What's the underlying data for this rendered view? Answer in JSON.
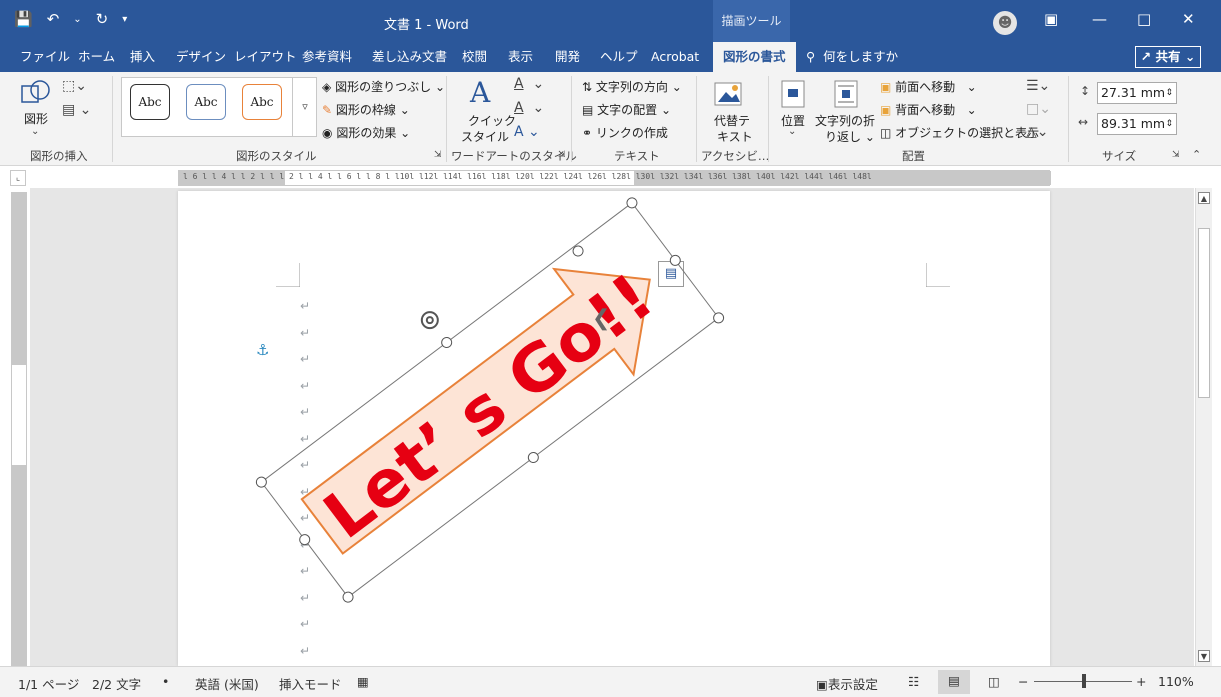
{
  "title_bar": {
    "document_title": "文書 1  -  Word",
    "context_tool": "描画ツール",
    "qat_icons": [
      "save-icon",
      "undo-icon",
      "redo-icon",
      "customize-icon"
    ]
  },
  "tabs": [
    {
      "label": "ファイル",
      "name": "tab-file"
    },
    {
      "label": "ホーム",
      "name": "tab-home"
    },
    {
      "label": "挿入",
      "name": "tab-insert"
    },
    {
      "label": "デザイン",
      "name": "tab-design"
    },
    {
      "label": "レイアウト",
      "name": "tab-layout"
    },
    {
      "label": "参考資料",
      "name": "tab-references"
    },
    {
      "label": "差し込み文書",
      "name": "tab-mailings"
    },
    {
      "label": "校閲",
      "name": "tab-review"
    },
    {
      "label": "表示",
      "name": "tab-view"
    },
    {
      "label": "開発",
      "name": "tab-developer"
    },
    {
      "label": "ヘルプ",
      "name": "tab-help"
    },
    {
      "label": "Acrobat",
      "name": "tab-acrobat"
    },
    {
      "label": "図形の書式",
      "name": "tab-shape-format"
    }
  ],
  "tell_me": "何をしますか",
  "share_label": "共有",
  "ribbon": {
    "insert_shapes": {
      "shape_label": "図形",
      "group_label": "図形の挿入"
    },
    "shape_styles": {
      "samples": [
        "Abc",
        "Abc",
        "Abc"
      ],
      "fill": "図形の塗りつぶし",
      "outline": "図形の枠線",
      "effects": "図形の効果",
      "group_label": "図形のスタイル"
    },
    "wordart": {
      "quick_style_1": "クイック",
      "quick_style_2": "スタイル",
      "letter": "A",
      "group_label": "ワードアートのスタイル"
    },
    "text": {
      "direction": "文字列の方向",
      "align": "文字の配置",
      "link": "リンクの作成",
      "group_label": "テキスト"
    },
    "accessibility": {
      "alt_1": "代替テ",
      "alt_2": "キスト",
      "group_label": "アクセシビ…"
    },
    "arrange": {
      "position": "位置",
      "wrap_1": "文字列の折",
      "wrap_2": "り返し",
      "bring_forward": "前面へ移動",
      "send_backward": "背面へ移動",
      "selection_pane": "オブジェクトの選択と表示",
      "group_label": "配置"
    },
    "size": {
      "height": "27.31 mm",
      "width": "89.31 mm",
      "group_label": "サイズ"
    }
  },
  "ruler_text": "l 6 l   l 4 l   l 2 l   l    l 2 l   l 4 l   l 6 l   l 8 l   l10l   l12l   l14l   l16l   l18l   l20l   l22l   l24l   l26l   l28l   l30l   l32l   l34l   l36l   l38l   l40l   l42l   l44l   l46l   l48l",
  "document": {
    "wordart_text": "Let’ s Go!!",
    "paragraph_mark": "↵",
    "paragraph_count": 14
  },
  "colors": {
    "title_blue": "#2b579a",
    "wordart_red": "#e60012",
    "arrow_fill": "#fde4d6",
    "arrow_stroke": "#e8823a"
  },
  "status_bar": {
    "page": "1/1 ページ",
    "words": "2/2 文字",
    "bullet": "•",
    "language": "英語 (米国)",
    "mode": "挿入モード",
    "display_settings": "表示設定",
    "zoom": "110%"
  }
}
